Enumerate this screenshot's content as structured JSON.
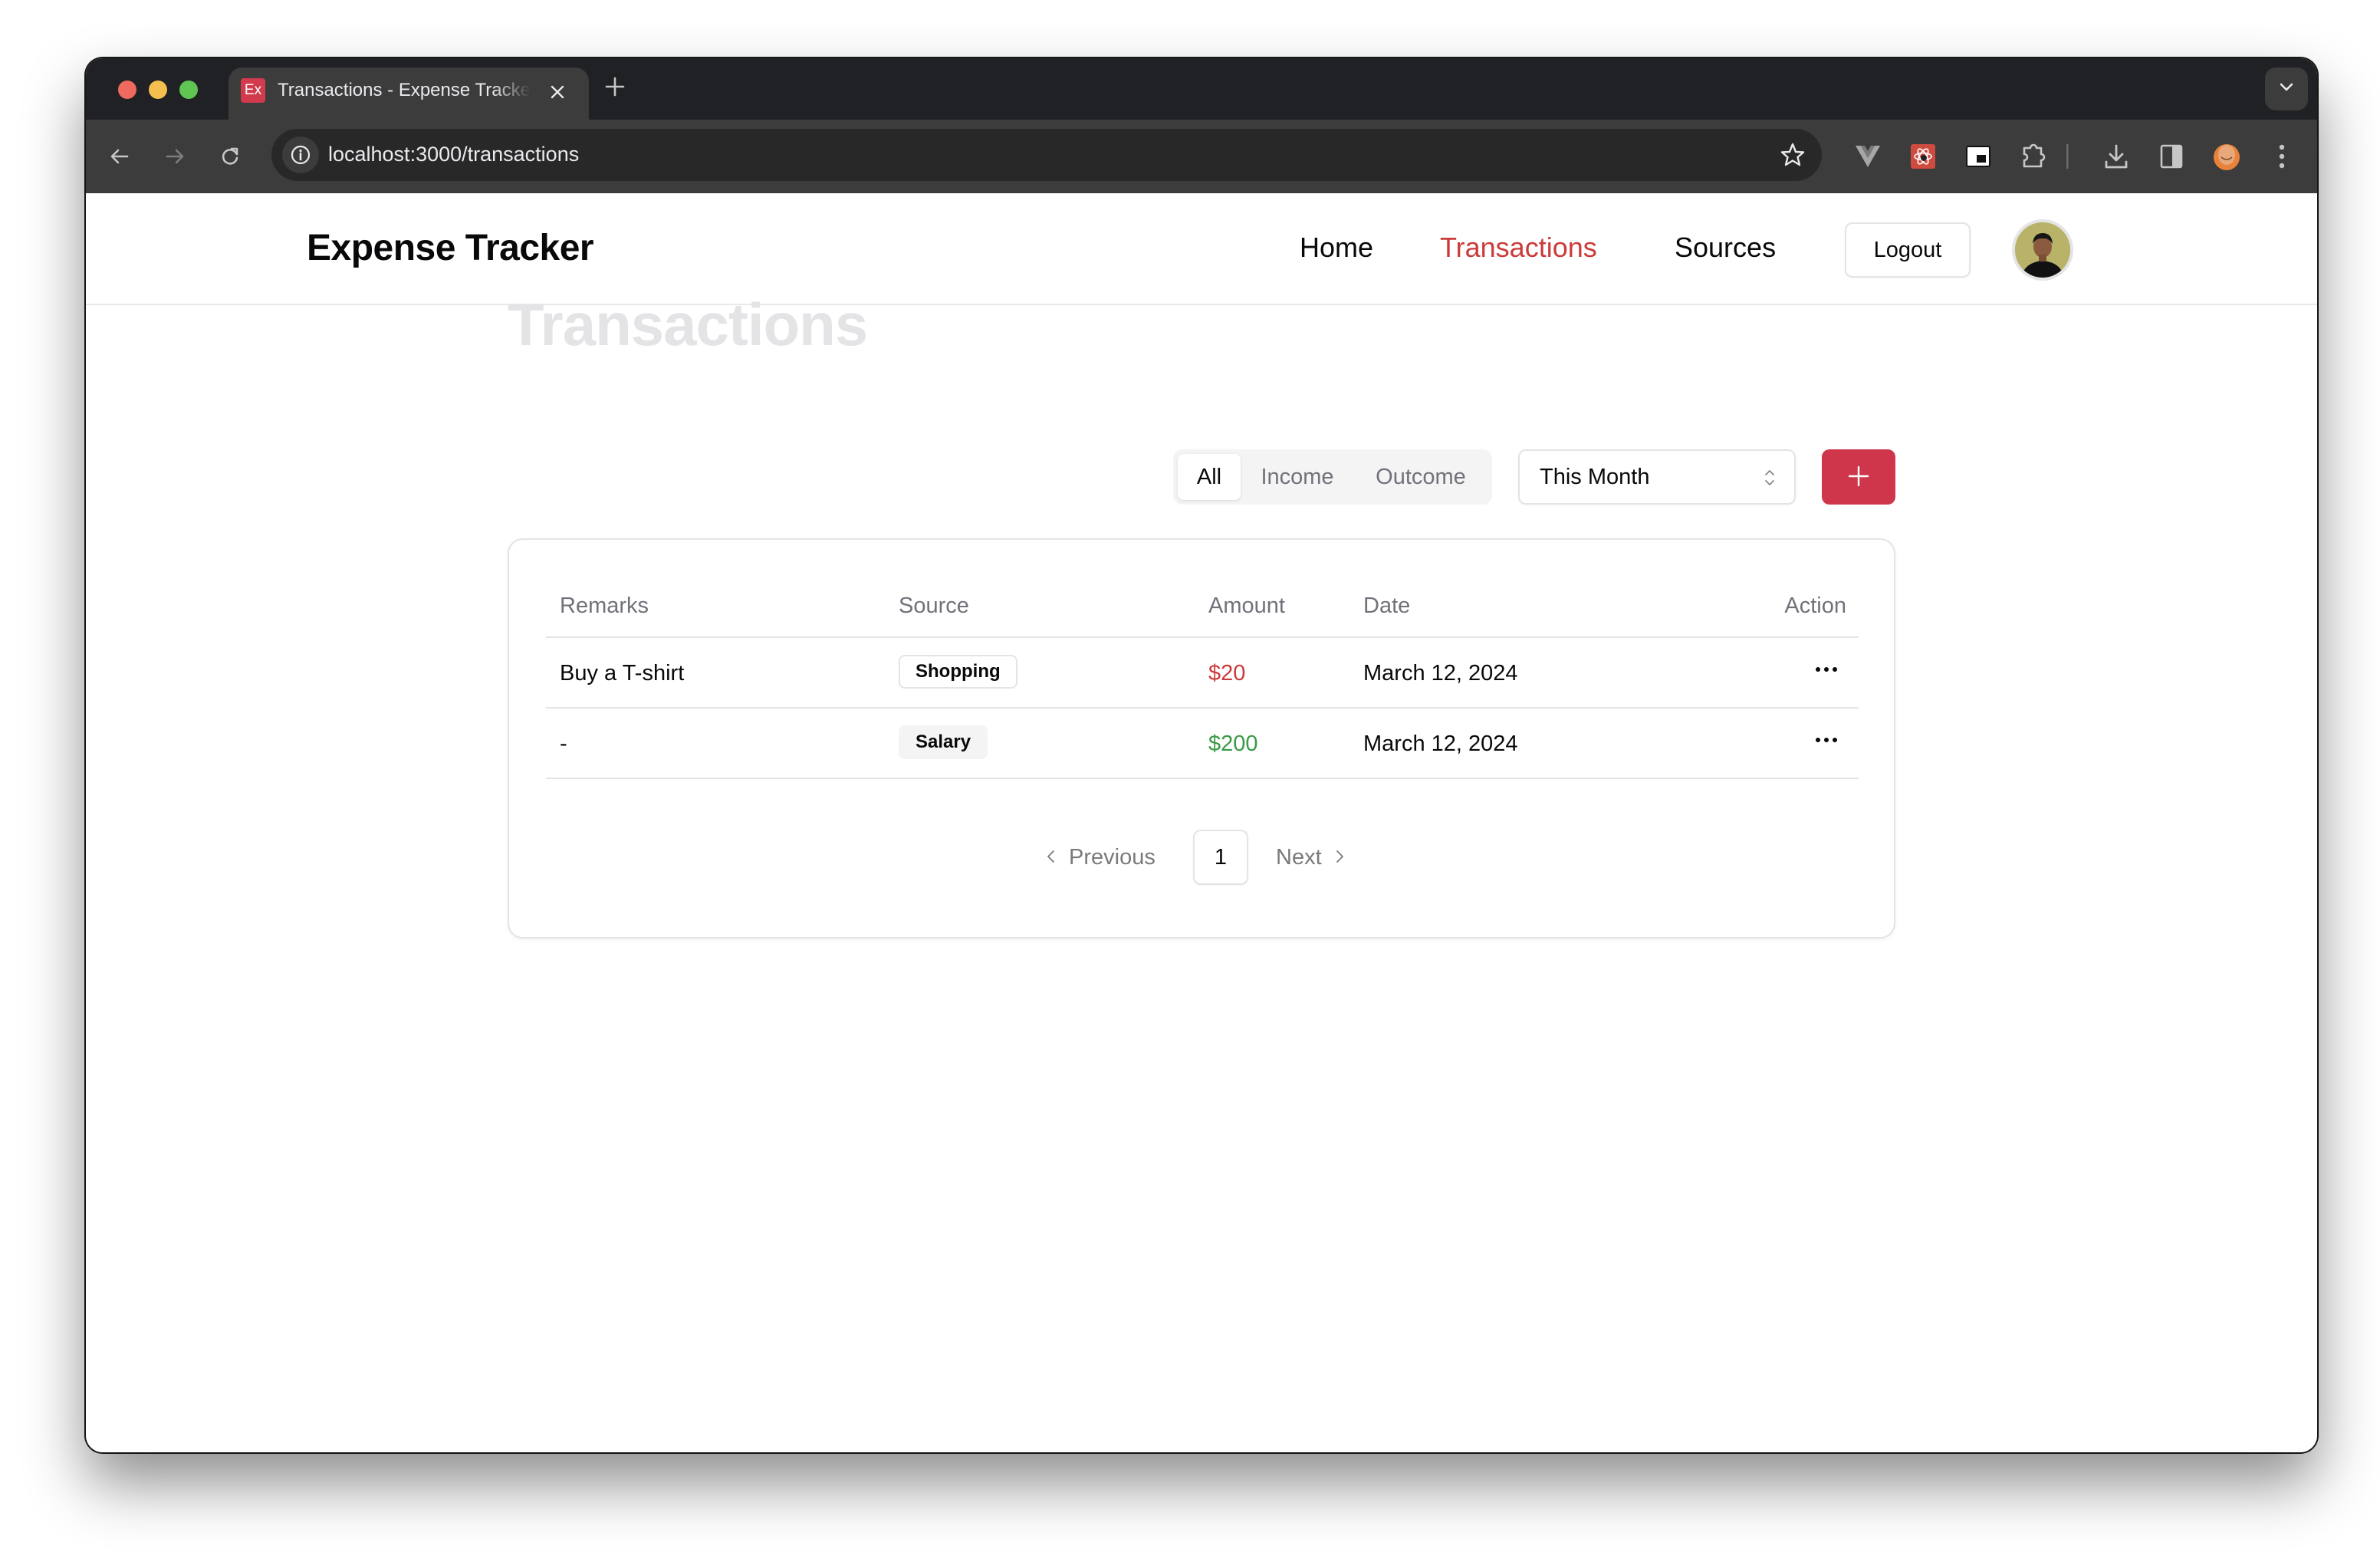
{
  "browser": {
    "tab": {
      "favicon_text": "Ex",
      "title": "Transactions - Expense Tracker",
      "close_icon": "close-icon"
    },
    "new_tab_icon": "plus-icon",
    "tab_search_icon": "chevron-down-icon",
    "nav": {
      "back_icon": "arrow-left-icon",
      "forward_icon": "arrow-right-icon",
      "reload_icon": "reload-icon"
    },
    "omnibox": {
      "site_info_icon": "info-icon",
      "url": "localhost:3000/transactions",
      "bookmark_icon": "star-icon"
    },
    "extensions": [
      "vue-devtools-icon",
      "react-devtools-icon",
      "picture-in-picture-icon",
      "extensions-puzzle-icon",
      "download-icon",
      "side-panel-icon",
      "profile-avatar-icon",
      "kebab-menu-icon"
    ]
  },
  "app": {
    "brand": "Expense Tracker",
    "nav": [
      {
        "label": "Home",
        "active": false
      },
      {
        "label": "Transactions",
        "active": true
      },
      {
        "label": "Sources",
        "active": false
      }
    ],
    "logout_label": "Logout",
    "accent_color": "#cc3a3a",
    "primary_color": "#cf364c"
  },
  "page": {
    "title": "Transactions",
    "filter_tabs": [
      {
        "label": "All",
        "active": true
      },
      {
        "label": "Income",
        "active": false
      },
      {
        "label": "Outcome",
        "active": false
      }
    ],
    "period_select": {
      "value": "This Month"
    },
    "add_button_icon": "plus-icon",
    "table": {
      "columns": [
        "Remarks",
        "Source",
        "Amount",
        "Date",
        "Action"
      ],
      "rows": [
        {
          "remarks": "Buy a T-shirt",
          "source": "Shopping",
          "source_style": "outline",
          "amount": "$20",
          "type": "outcome",
          "date": "March 12, 2024"
        },
        {
          "remarks": "-",
          "source": "Salary",
          "source_style": "secondary",
          "amount": "$200",
          "type": "income",
          "date": "March 12, 2024"
        }
      ]
    },
    "pagination": {
      "previous_label": "Previous",
      "current_page": "1",
      "next_label": "Next"
    }
  }
}
